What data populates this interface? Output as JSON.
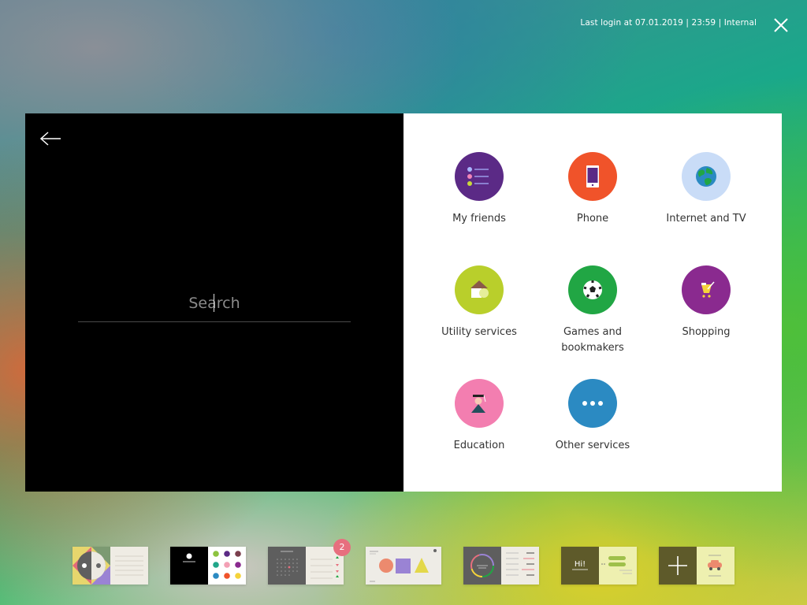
{
  "header": {
    "last_login": "Last login at 07.01.2019 | 23:59 | Internal",
    "close_icon": "close-icon"
  },
  "search": {
    "placeholder": "Search",
    "value": "",
    "back_icon": "arrow-left-icon"
  },
  "services": [
    {
      "id": "my-friends",
      "label": "My friends",
      "color": "#5b2a86",
      "icon": "friends-list-icon"
    },
    {
      "id": "phone",
      "label": "Phone",
      "color": "#f0532a",
      "icon": "phone-icon"
    },
    {
      "id": "internet-tv",
      "label": "Internet and TV",
      "color": "#c9dcf7",
      "icon": "globe-icon"
    },
    {
      "id": "utility-services",
      "label": "Utility services",
      "color": "#b9cf2b",
      "icon": "house-icon"
    },
    {
      "id": "games-bookmakers",
      "label": "Games and bookmakers",
      "color": "#21a644",
      "icon": "soccer-ball-icon"
    },
    {
      "id": "shopping",
      "label": "Shopping",
      "color": "#8a2a8f",
      "icon": "shopping-cart-icon"
    },
    {
      "id": "education",
      "label": "Education",
      "color": "#f37eb0",
      "icon": "graduate-icon"
    },
    {
      "id": "other-services",
      "label": "Other services",
      "color": "#2b8ac2",
      "icon": "more-dots-icon"
    }
  ],
  "dock": {
    "items": [
      {
        "id": "thumb-1",
        "name": "profile-app-thumbnail"
      },
      {
        "id": "thumb-2",
        "name": "contacts-app-thumbnail"
      },
      {
        "id": "thumb-3",
        "name": "calendar-app-thumbnail",
        "badge": "2"
      },
      {
        "id": "thumb-4",
        "name": "shapes-app-thumbnail"
      },
      {
        "id": "thumb-5",
        "name": "dial-app-thumbnail"
      },
      {
        "id": "thumb-6",
        "name": "chat-app-thumbnail",
        "text": "Hi!"
      },
      {
        "id": "thumb-7",
        "name": "add-app-thumbnail"
      }
    ]
  }
}
